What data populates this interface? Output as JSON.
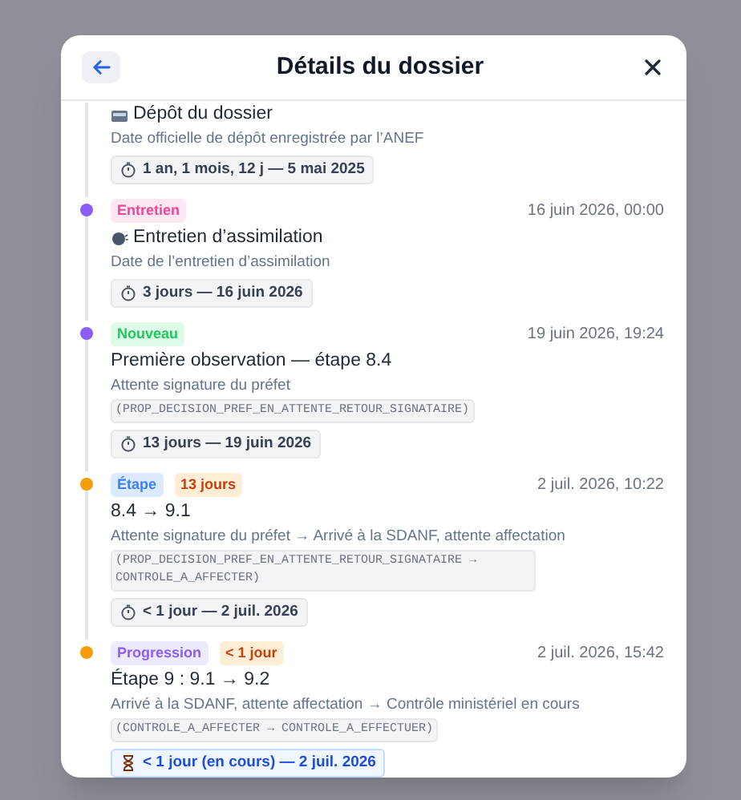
{
  "dialog": {
    "title": "Détails du dossier"
  },
  "events": [
    {
      "kind": "deposit",
      "title": "Dépôt du dossier",
      "description": "Date officielle de dépôt enregistrée par l’ANEF",
      "duration": {
        "text": "1 an, 1 mois, 12 j — 5 mai 2025",
        "current": false
      }
    },
    {
      "kind": "interview",
      "color": "#8b5cf6",
      "badges": [
        {
          "label": "Entretien",
          "color": "#ec4899"
        }
      ],
      "date": "16 juin 2026, 00:00",
      "title": "Entretien d’assimilation",
      "description": "Date de l’entretien d’assimilation",
      "duration": {
        "text": "3 jours — 16 juin 2026",
        "current": false
      }
    },
    {
      "kind": "status",
      "color": "#8b5cf6",
      "badges": [
        {
          "label": "Nouveau",
          "color": "#22c55e"
        }
      ],
      "date": "19 juin 2026, 19:24",
      "title": "Première observation — étape 8.4",
      "description": "Attente signature du préfet",
      "code": "(PROP_DECISION_PREF_EN_ATTENTE_RETOUR_SIGNATAIRE)",
      "duration": {
        "text": "13 jours — 19 juin 2026",
        "current": false
      }
    },
    {
      "kind": "status",
      "color": "#f59e0b",
      "badges": [
        {
          "label": "Étape",
          "color": "#3b82f6"
        },
        {
          "label": "13 jours",
          "color": "#c2410c"
        }
      ],
      "date": "2 juil. 2026, 10:22",
      "title": "8.4 → 9.1",
      "description": "Attente signature du préfet → Arrivé à la SDANF, attente affectation",
      "code": "(PROP_DECISION_PREF_EN_ATTENTE_RETOUR_SIGNATAIRE → CONTROLE_A_AFFECTER)",
      "duration": {
        "text": "< 1 jour — 2 juil. 2026",
        "current": false
      }
    },
    {
      "kind": "status",
      "color": "#f59e0b",
      "badges": [
        {
          "label": "Progression",
          "color": "#8b5cf6"
        },
        {
          "label": "< 1 jour",
          "color": "#c2410c"
        }
      ],
      "date": "2 juil. 2026, 15:42",
      "title": "Étape 9 : 9.1 → 9.2",
      "description": "Arrivé à la SDANF, attente affectation → Contrôle ministériel en cours",
      "code": "(CONTROLE_A_AFFECTER → CONTROLE_A_EFFECTUER)",
      "duration": {
        "text": "< 1 jour (en cours) — 2 juil. 2026",
        "current": true
      }
    }
  ]
}
